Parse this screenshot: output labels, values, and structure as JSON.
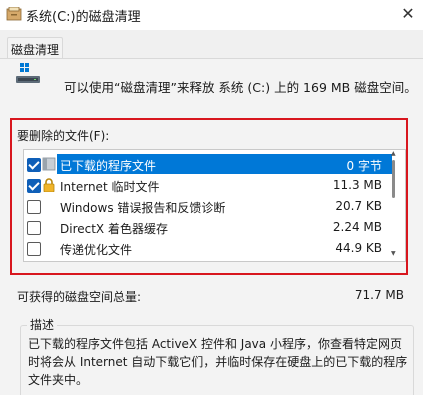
{
  "window": {
    "title": "系统(C:)的磁盘清理",
    "close_glyph": "✕"
  },
  "tabs": [
    {
      "label": "磁盘清理"
    }
  ],
  "info": {
    "text": "可以使用“磁盘清理”来释放 系统 (C:) 上的 169 MB 磁盘空间。"
  },
  "files_section": {
    "label": "要删除的文件(F):",
    "items": [
      {
        "label": "已下载的程序文件",
        "size": "0 字节",
        "checked": true,
        "selected": true,
        "icon": "folder-icon"
      },
      {
        "label": "Internet 临时文件",
        "size": "11.3 MB",
        "checked": true,
        "selected": false,
        "icon": "lock-icon"
      },
      {
        "label": "Windows 错误报告和反馈诊断",
        "size": "20.7 KB",
        "checked": false,
        "selected": false,
        "icon": "blank-icon"
      },
      {
        "label": "DirectX 着色器缓存",
        "size": "2.24 MB",
        "checked": false,
        "selected": false,
        "icon": "blank-icon"
      },
      {
        "label": "传递优化文件",
        "size": "44.9 KB",
        "checked": false,
        "selected": false,
        "icon": "blank-icon"
      }
    ]
  },
  "space": {
    "label": "可获得的磁盘空间总量:",
    "value": "71.7 MB"
  },
  "description": {
    "title": "描述",
    "text": "已下载的程序文件包括 ActiveX 控件和 Java 小程序，你查看特定网页时将会从 Internet 自动下载它们，并临时保存在硬盘上的已下载的程序文件夹中。"
  },
  "colors": {
    "selection": "#0078d7",
    "highlight_frame": "#d8161e",
    "checkbox": "#0f5fb8"
  }
}
